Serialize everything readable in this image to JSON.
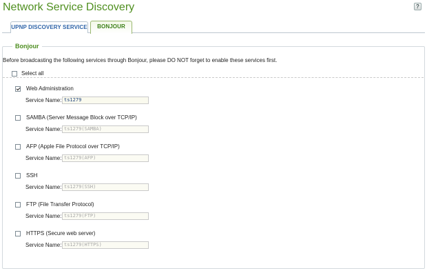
{
  "header": {
    "title": "Network Service Discovery",
    "help_icon": "help-icon",
    "help_glyph": "?"
  },
  "tabs": [
    {
      "label": "UPNP DISCOVERY SERVICE",
      "active": false
    },
    {
      "label": "BONJOUR",
      "active": true
    }
  ],
  "section": {
    "legend": "Bonjour",
    "intro": "Before broadcasting the following services through Bonjour, please DO NOT forget to enable these services first.",
    "select_all_label": "Select all",
    "select_all_checked": false
  },
  "services": [
    {
      "label": "Web Administration",
      "checked": true,
      "field_label": "Service Name:",
      "value": "ts1279",
      "enabled": true
    },
    {
      "label": "SAMBA (Server Message Block over TCP/IP)",
      "checked": false,
      "field_label": "Service Name:",
      "value": "ts1279(SAMBA)",
      "enabled": false
    },
    {
      "label": "AFP (Apple File Protocol over TCP/IP)",
      "checked": false,
      "field_label": "Service Name:",
      "value": "ts1279(AFP)",
      "enabled": false
    },
    {
      "label": "SSH",
      "checked": false,
      "field_label": "Service Name:",
      "value": "ts1279(SSH)",
      "enabled": false
    },
    {
      "label": "FTP (File Transfer Protocol)",
      "checked": false,
      "field_label": "Service Name:",
      "value": "ts1279(FTP)",
      "enabled": false
    },
    {
      "label": "HTTPS (Secure web server)",
      "checked": false,
      "field_label": "Service Name:",
      "value": "ts1279(HTTPS)",
      "enabled": false
    }
  ],
  "colors": {
    "title_green": "#4f8f1f",
    "tab_blue": "#2f64a8",
    "input_bg": "#fafaee"
  }
}
